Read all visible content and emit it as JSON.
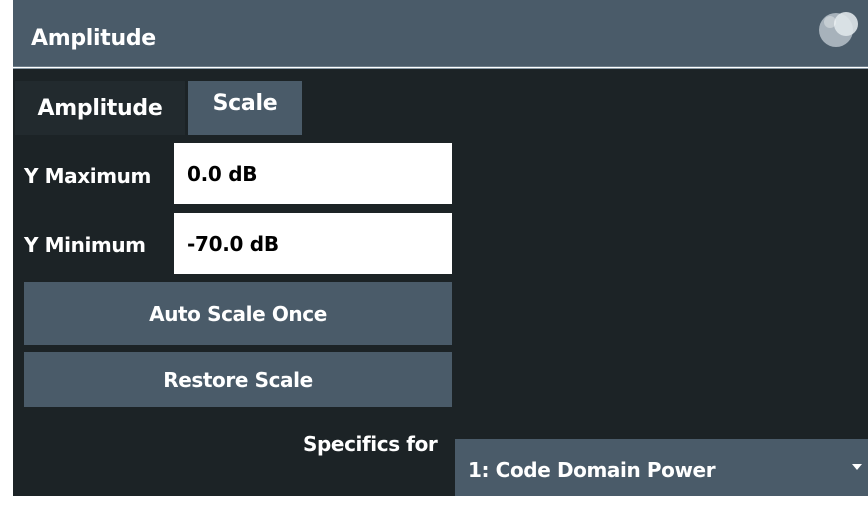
{
  "dialog": {
    "title": "Amplitude",
    "help_icon": "help-bubble-icon"
  },
  "tabs": [
    {
      "label": "Amplitude",
      "selected": false
    },
    {
      "label": "Scale",
      "selected": true
    }
  ],
  "y_maximum": {
    "label": "Y Maximum",
    "value": "0.0 dB"
  },
  "y_minimum": {
    "label": "Y Minimum",
    "value": "-70.0 dB"
  },
  "buttons": {
    "auto_scale_once": "Auto Scale Once",
    "restore_scale": "Restore Scale"
  },
  "specifics": {
    "label": "Specifics for",
    "selected": "1: Code Domain Power",
    "dropdown_icon": "chevron-down-icon"
  },
  "colors": {
    "title_bar": "#4a5b69",
    "panel_bg": "#1c2326",
    "button_bg": "#4a5b69",
    "text": "#ffffff"
  }
}
